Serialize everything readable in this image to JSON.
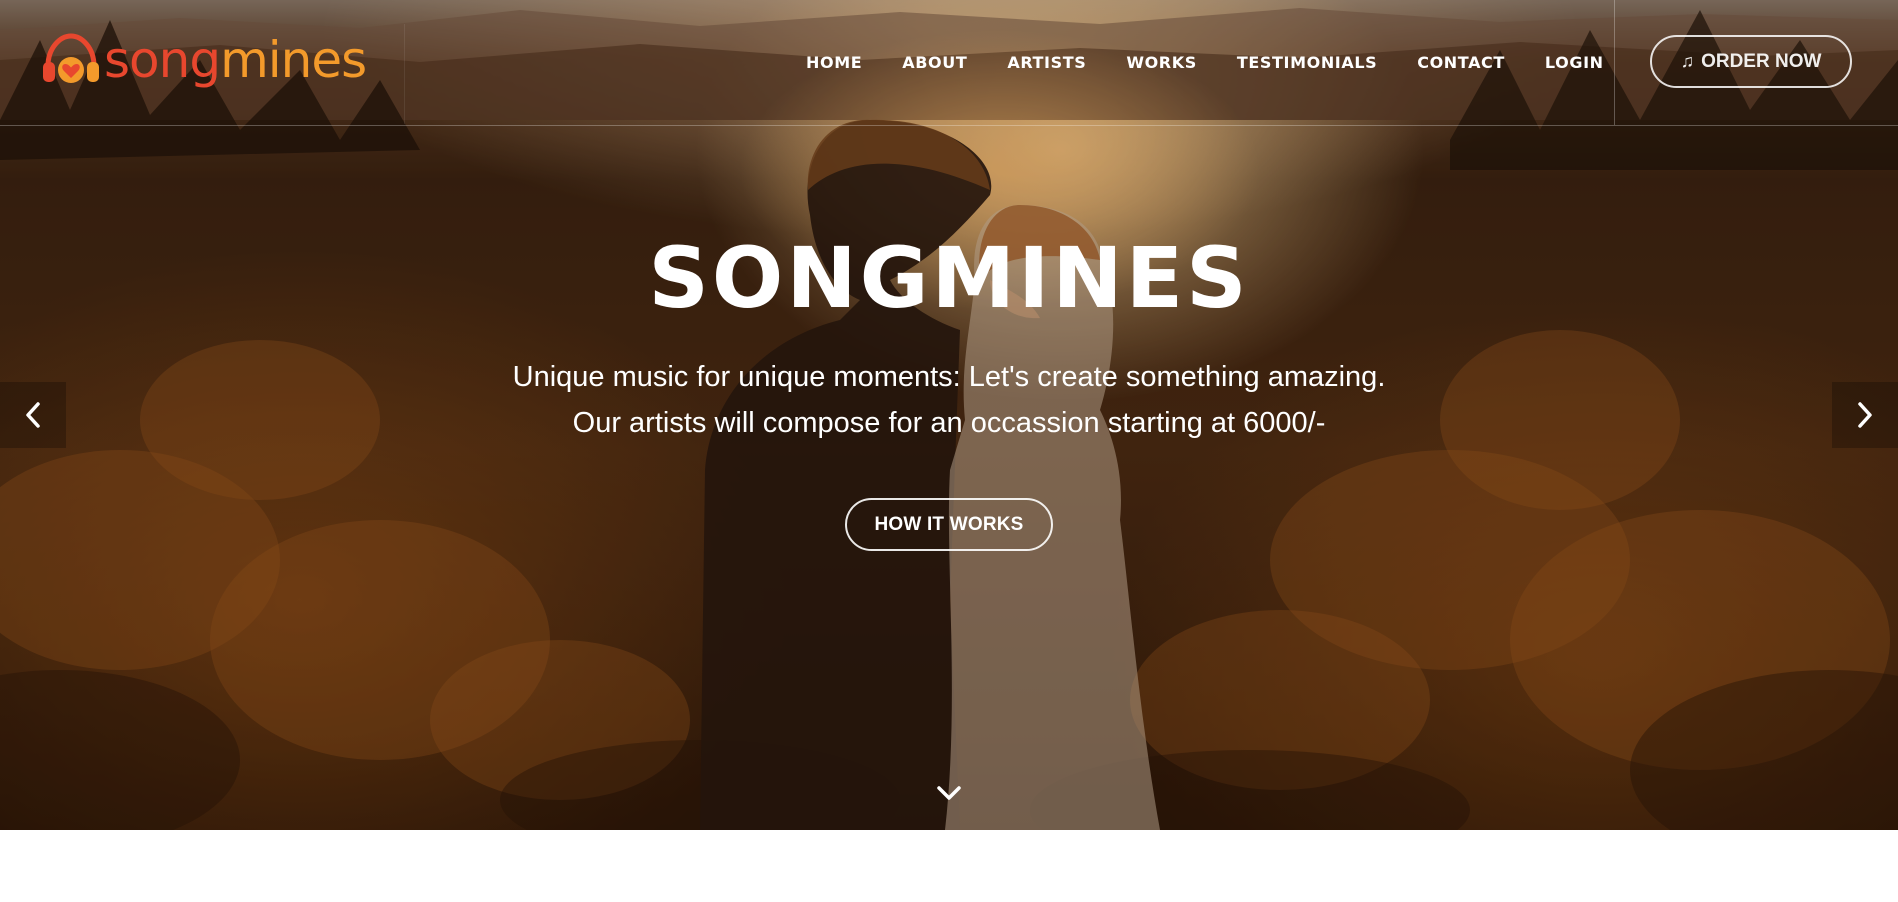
{
  "brand": {
    "name_part1": "song",
    "name_part2": "mines",
    "logo_icon": "headphones-heart-icon",
    "color_primary": "#e8472e",
    "color_secondary": "#f39a2b"
  },
  "nav": {
    "items": [
      {
        "label": "HOME"
      },
      {
        "label": "ABOUT"
      },
      {
        "label": "ARTISTS"
      },
      {
        "label": "WORKS"
      },
      {
        "label": "TESTIMONIALS"
      },
      {
        "label": "CONTACT"
      },
      {
        "label": "LOGIN"
      }
    ],
    "order_button": {
      "label": "ORDER NOW",
      "icon": "music-note-icon"
    }
  },
  "hero": {
    "title": "SONGMINES",
    "subtitle_line1": "Unique music for unique moments: Let's create something amazing.",
    "subtitle_line2": "Our artists will compose for an occassion starting at 6000/-",
    "cta_label": "HOW IT WORKS",
    "prev_icon": "chevron-left-icon",
    "next_icon": "chevron-right-icon",
    "scroll_icon": "chevron-down-icon"
  }
}
